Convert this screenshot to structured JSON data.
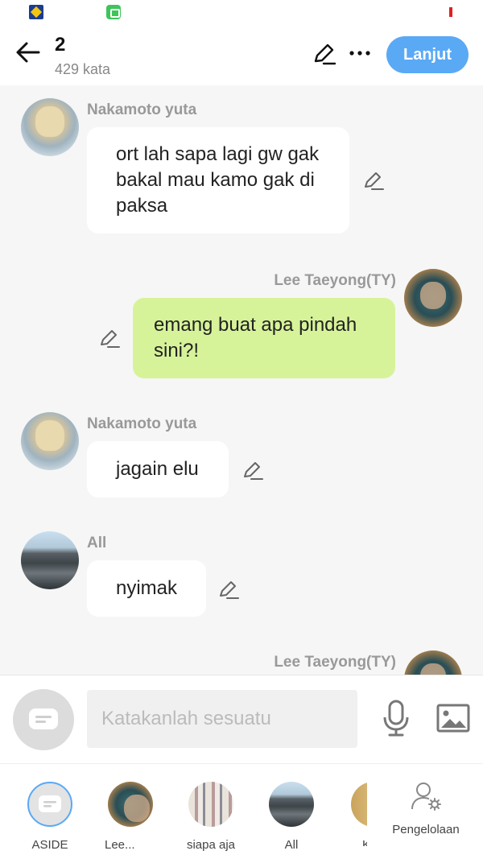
{
  "header": {
    "title": "2",
    "word_count": "429 kata",
    "next_label": "Lanjut"
  },
  "messages": [
    {
      "sender": "Nakamoto yuta",
      "text": "ort lah sapa lagi gw gak bakal mau kamo gak di paksa"
    },
    {
      "sender": "Lee Taeyong(TY)",
      "text": "emang buat apa pindah sini?!"
    },
    {
      "sender": "Nakamoto yuta",
      "text": "jagain elu"
    },
    {
      "sender": "All",
      "text": "nyimak"
    },
    {
      "sender": "Lee Taeyong(TY)",
      "text": ""
    }
  ],
  "composer": {
    "placeholder": "Katakanlah sesuatu"
  },
  "tabs": [
    {
      "label": "ASIDE"
    },
    {
      "label": "Lee..."
    },
    {
      "label": "siapa aja"
    },
    {
      "label": "All"
    },
    {
      "label": "K"
    }
  ],
  "manage_label": "Pengelolaan",
  "colors": {
    "accent": "#5aa9f5",
    "my_bubble": "#d7f39a",
    "background": "#f6f6f6"
  }
}
